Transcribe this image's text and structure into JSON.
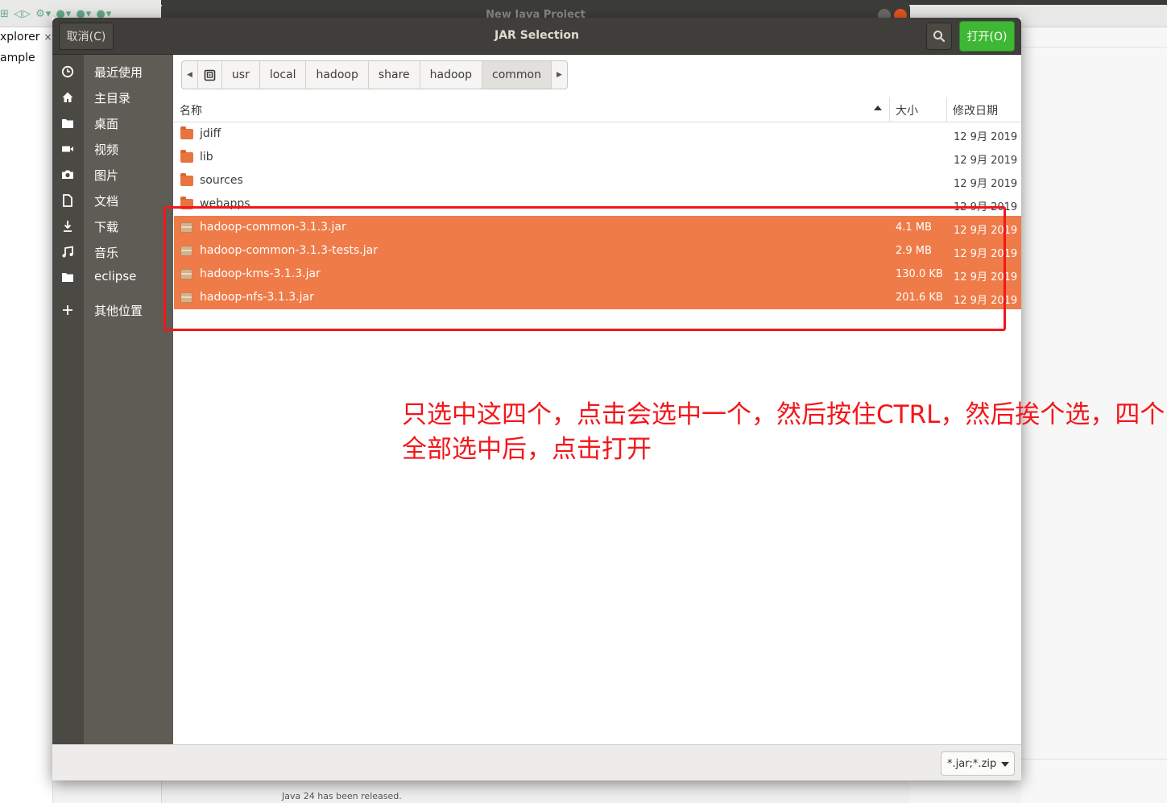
{
  "background": {
    "window_title": "New Java Project",
    "explorer_tab": "xplorer",
    "explorer_close": "×",
    "explorer_item": "ample",
    "toolbar_icons": "⊞ ◁▷ ⚙▾ ●▾ ●▾ ●▾",
    "status_text": "Java 24 has been released."
  },
  "dialog": {
    "title": "JAR Selection",
    "cancel_label": "取消(C)",
    "open_label": "打开(O)",
    "search_icon": "search-icon"
  },
  "sidebar": {
    "items": [
      {
        "label": "最近使用",
        "icon": "clock-icon"
      },
      {
        "label": "主目录",
        "icon": "home-icon"
      },
      {
        "label": "桌面",
        "icon": "folder-icon"
      },
      {
        "label": "视频",
        "icon": "video-icon"
      },
      {
        "label": "图片",
        "icon": "camera-icon"
      },
      {
        "label": "文档",
        "icon": "document-icon"
      },
      {
        "label": "下载",
        "icon": "download-icon"
      },
      {
        "label": "音乐",
        "icon": "music-icon"
      },
      {
        "label": "eclipse",
        "icon": "folder-icon"
      },
      {
        "label": "其他位置",
        "icon": "plus-icon"
      }
    ]
  },
  "path": {
    "left_arrow": "◀",
    "right_arrow": "▶",
    "crumbs": [
      "usr",
      "local",
      "hadoop",
      "share",
      "hadoop",
      "common"
    ],
    "active": "common"
  },
  "columns": {
    "name": "名称",
    "size": "大小",
    "modified": "修改日期"
  },
  "files": [
    {
      "name": "jdiff",
      "size": "",
      "date": "12 9月 2019",
      "type": "folder",
      "selected": false
    },
    {
      "name": "lib",
      "size": "",
      "date": "12 9月 2019",
      "type": "folder",
      "selected": false
    },
    {
      "name": "sources",
      "size": "",
      "date": "12 9月 2019",
      "type": "folder",
      "selected": false
    },
    {
      "name": "webapps",
      "size": "",
      "date": "12 9月 2019",
      "type": "folder",
      "selected": false
    },
    {
      "name": "hadoop-common-3.1.3.jar",
      "size": "4.1 MB",
      "date": "12 9月 2019",
      "type": "jar",
      "selected": true
    },
    {
      "name": "hadoop-common-3.1.3-tests.jar",
      "size": "2.9 MB",
      "date": "12 9月 2019",
      "type": "jar",
      "selected": true
    },
    {
      "name": "hadoop-kms-3.1.3.jar",
      "size": "130.0 KB",
      "date": "12 9月 2019",
      "type": "jar",
      "selected": true
    },
    {
      "name": "hadoop-nfs-3.1.3.jar",
      "size": "201.6 KB",
      "date": "12 9月 2019",
      "type": "jar",
      "selected": true
    }
  ],
  "filter": {
    "value": "*.jar;*.zip"
  },
  "annotation": {
    "text": "只选中这四个，点击会选中一个，然后按住CTRL，然后挨个选，四个全部选中后，点击打开",
    "color": "#f3161a"
  },
  "colors": {
    "selection": "#ef7b48",
    "open_button": "#3eb834",
    "headerbar": "#3f3e3a",
    "sidebar": "#5e5c55"
  }
}
